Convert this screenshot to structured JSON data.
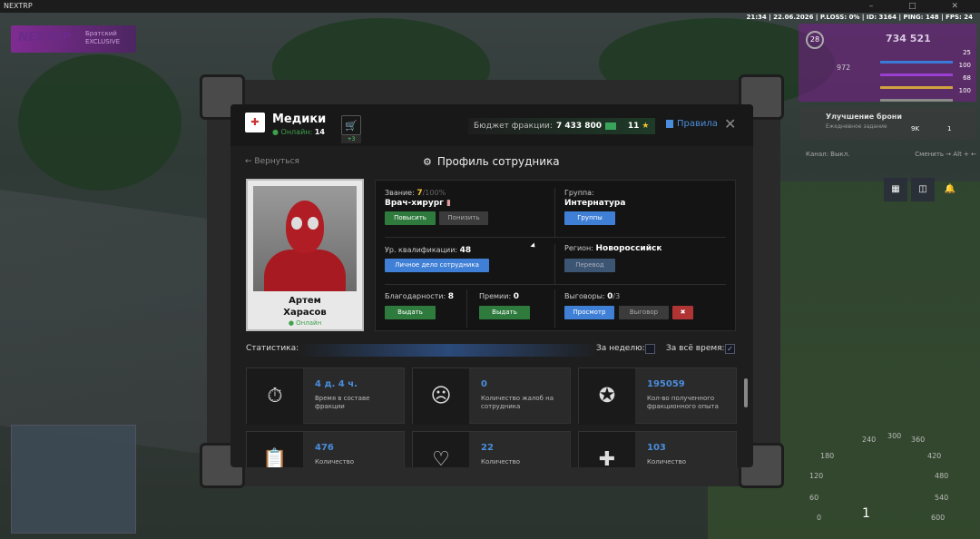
{
  "window": {
    "title": "NEXTRP",
    "controls": "– □ ✕"
  },
  "stats_line": "21:34 | 22.06.2026 | P.LOSS: 0% | ID: 3164 | PING: 148 | FPS: 24",
  "logo": {
    "text": "NEXTRP",
    "sub": "Братский\nEXCLUSIVE"
  },
  "hud": {
    "level": "28",
    "money": "734 521",
    "value_972": "972",
    "bars": [
      "25",
      "100",
      "68",
      "100"
    ],
    "bar_colors": [
      "#3a7ad8",
      "#9a3fd2",
      "#d2a33f",
      "#8a8a8a"
    ]
  },
  "upgrade": {
    "title": "Улучшение брони",
    "sub": "Ежедневное задание",
    "price1": "9K",
    "price2": "1"
  },
  "channel": {
    "label": "Канал: Выкл.",
    "switch": "Сменить → Alt + ←"
  },
  "speedo": {
    "ticks": [
      "240",
      "300",
      "360",
      "180",
      "420",
      "120",
      "480",
      "60",
      "540",
      "0",
      "600"
    ],
    "gear": "1"
  },
  "faction": {
    "name": "Медики",
    "online_label": "Онлайн:",
    "online_count": "14",
    "cart_badge": "+3"
  },
  "budget": {
    "label": "Бюджет фракции:",
    "amount": "7 433 800",
    "stars": "11"
  },
  "rules_label": "Правила",
  "back_label": "Вернуться",
  "page_title": "Профиль сотрудника",
  "employee": {
    "first_name": "Артем",
    "last_name": "Харасов",
    "status": "Онлайн"
  },
  "rank": {
    "label": "Звание:",
    "value": "7",
    "max": "/100%",
    "title": "Врач-хирург",
    "promote": "Повысить",
    "demote": "Понизить"
  },
  "group": {
    "label": "Группа:",
    "value": "Интернатура",
    "button": "Группы"
  },
  "qualification": {
    "label": "Ур. квалификации:",
    "value": "48",
    "button": "Личное дело сотрудника"
  },
  "region": {
    "label": "Регион:",
    "value": "Новороссийск",
    "button": "Перевод"
  },
  "thanks": {
    "label": "Благодарности:",
    "value": "8",
    "button": "Выдать"
  },
  "bonuses": {
    "label": "Премии:",
    "value": "0",
    "button": "Выдать"
  },
  "reprimands": {
    "label": "Выговоры:",
    "value": "0",
    "max": "/3",
    "view": "Просмотр",
    "give": "Выговор"
  },
  "statistics": {
    "label": "Статистика:",
    "week": "За неделю:",
    "all_time": "За всё время:",
    "cards": [
      {
        "value": "4 д. 4 ч.",
        "label": "Время в составе фракции"
      },
      {
        "value": "0",
        "label": "Количество жалоб на сотрудника"
      },
      {
        "value": "195059",
        "label": "Кол-во полученного фракционного опыта"
      },
      {
        "value": "476",
        "label": "Количество"
      },
      {
        "value": "22",
        "label": "Количество"
      },
      {
        "value": "103",
        "label": "Количество"
      }
    ]
  }
}
